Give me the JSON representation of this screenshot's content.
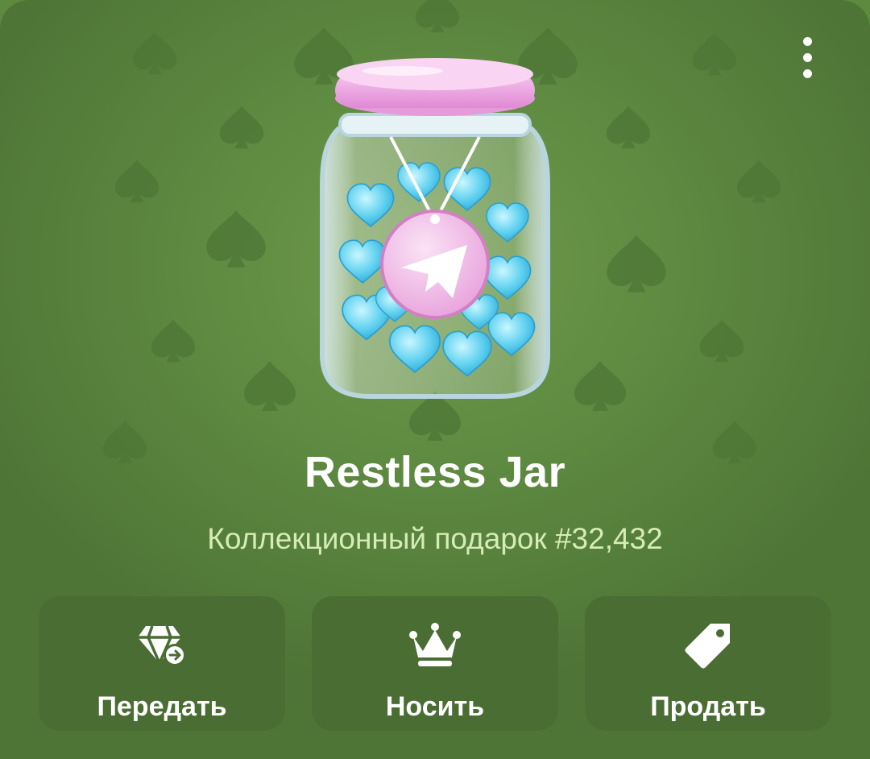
{
  "gift": {
    "title": "Restless Jar",
    "subtitle": "Коллекционный подарок #32,432"
  },
  "menu": {
    "icon": "more-vertical-icon"
  },
  "actions": [
    {
      "label": "Передать",
      "icon": "diamond-transfer-icon"
    },
    {
      "label": "Носить",
      "icon": "crown-icon"
    },
    {
      "label": "Продать",
      "icon": "price-tag-icon"
    }
  ],
  "colors": {
    "background": "#5f8b42",
    "pattern": "#4e7535",
    "button": "#4a6d33",
    "subtitle": "#d6ecb5",
    "text": "#ffffff"
  },
  "images": {
    "main": "jar-of-blue-hearts-with-pink-lid-and-telegram-badge",
    "backdrop_pattern": "spade-symbol"
  }
}
